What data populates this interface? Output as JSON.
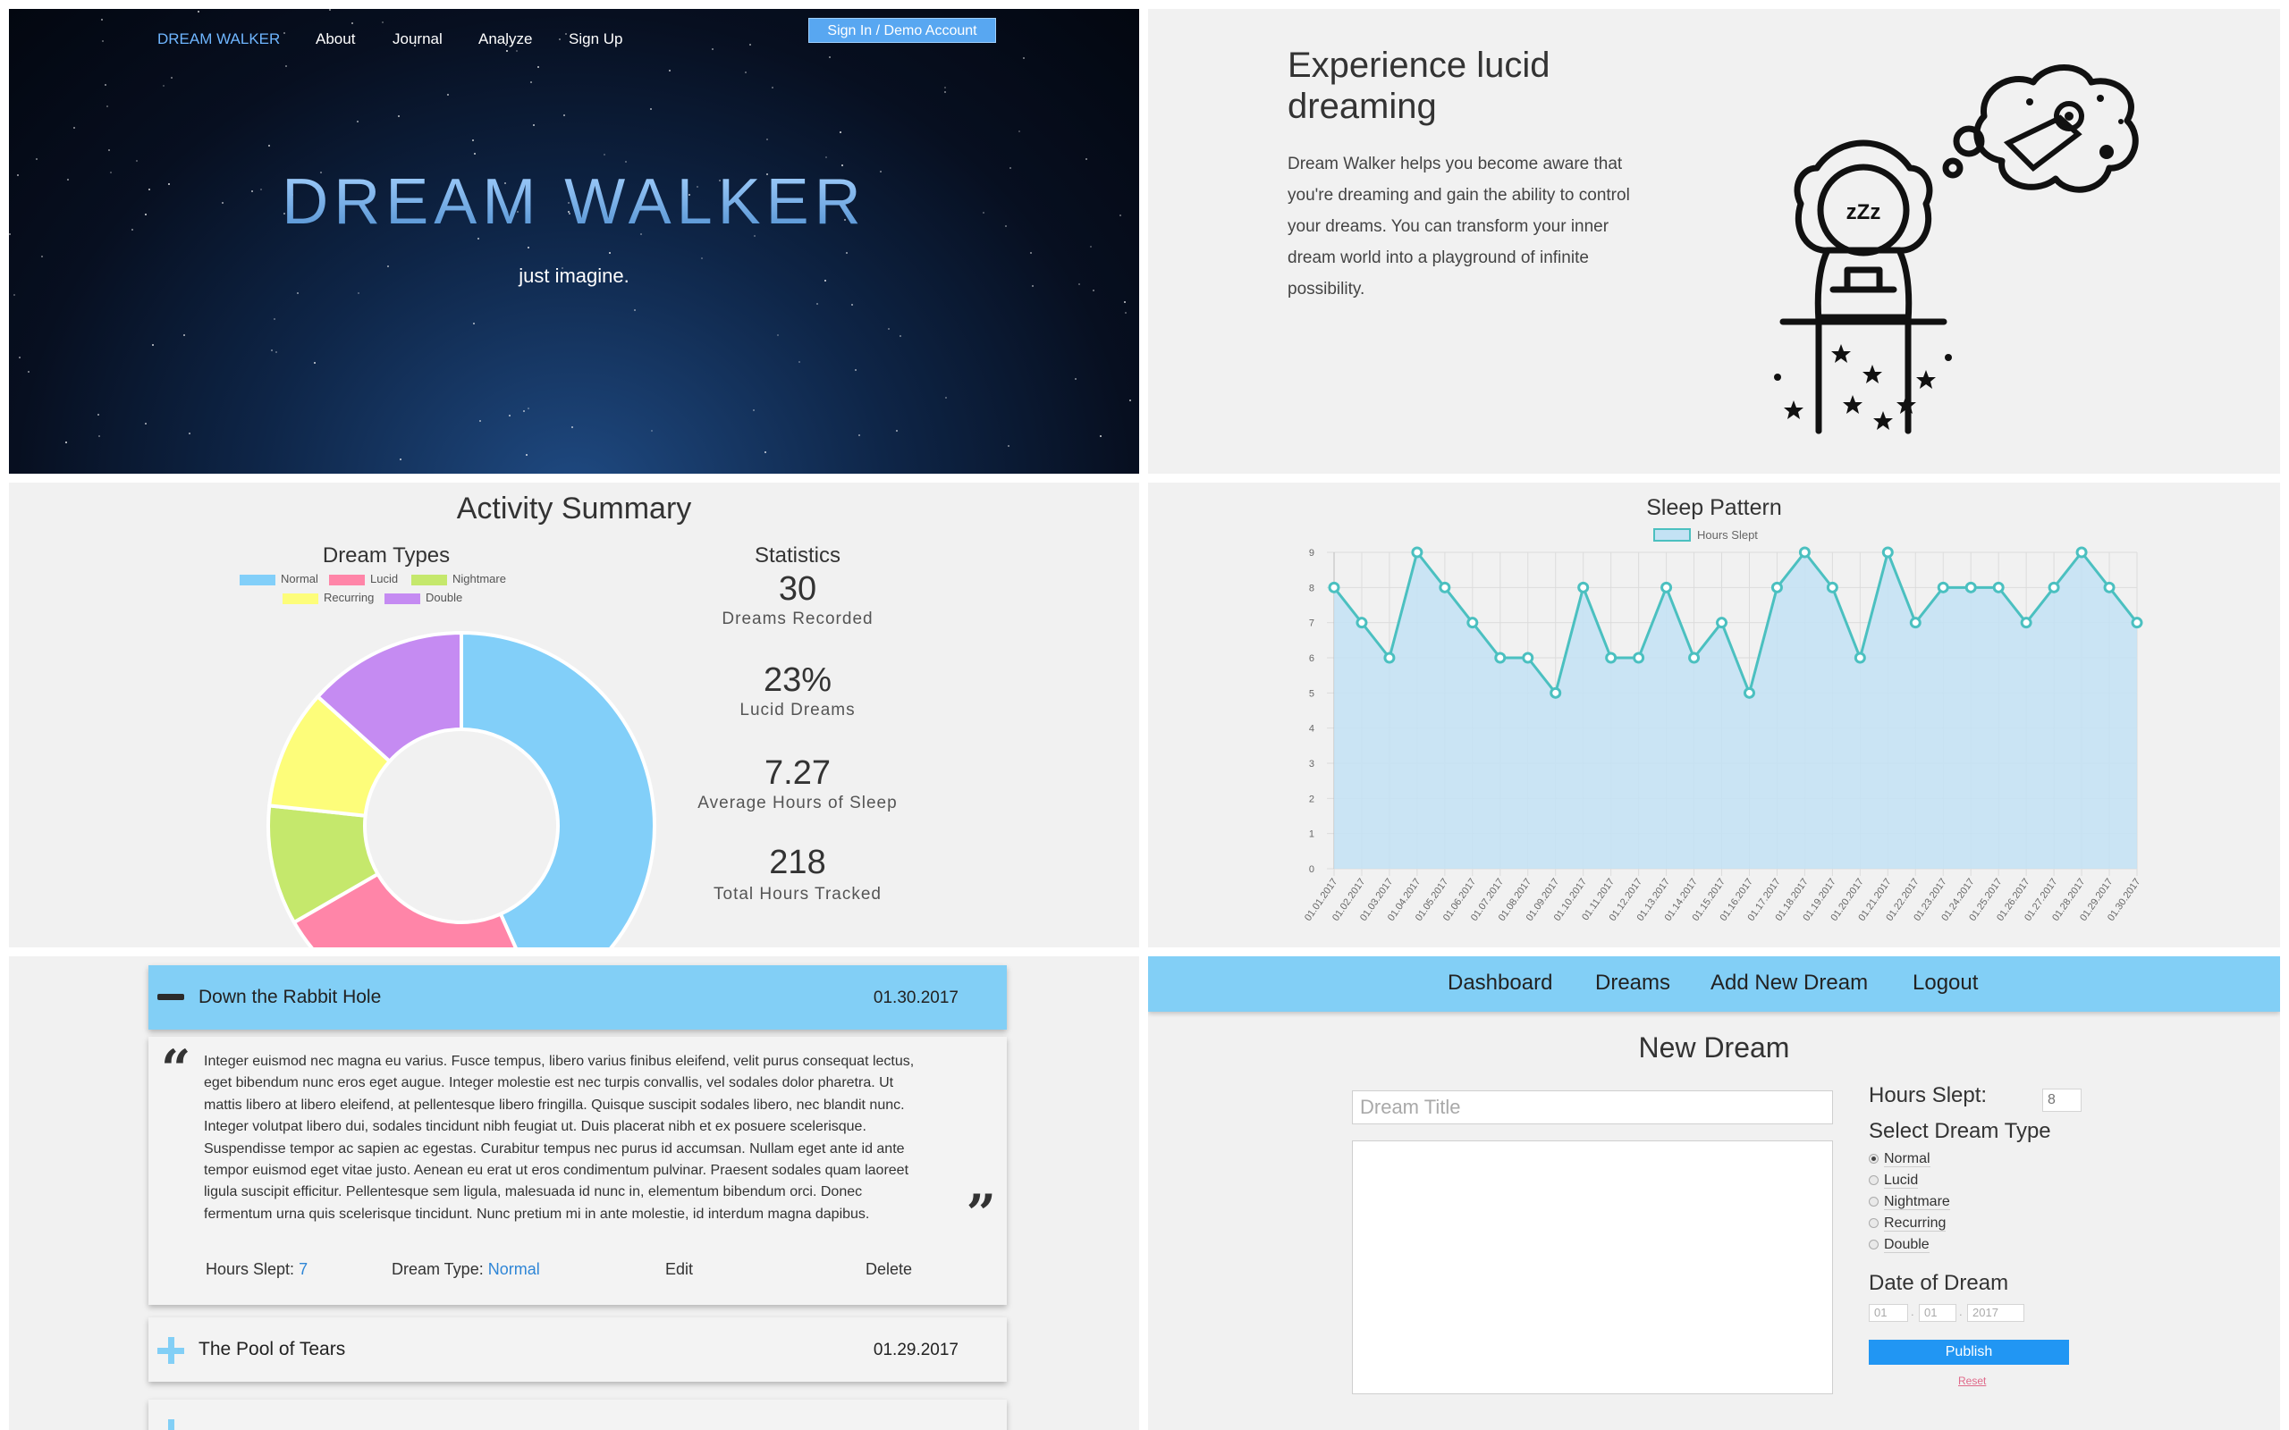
{
  "hero": {
    "nav": {
      "brand": "DREAM WALKER",
      "about": "About",
      "journal": "Journal",
      "analyze": "Analyze",
      "signup": "Sign Up",
      "signin": "Sign In / Demo Account"
    },
    "title": "DREAM WALKER",
    "subtitle": "just imagine."
  },
  "intro": {
    "title_line1": "Experience lucid",
    "title_line2": "dreaming",
    "text_lines": [
      "Dream Walker helps you become aware that",
      "you're dreaming and gain the ability to control",
      "your dreams. You can transform your inner",
      "dream world into a playground of infinite",
      "possibility."
    ],
    "illustration_label": "zZz"
  },
  "activity": {
    "title": "Activity Summary",
    "dream_types_title": "Dream Types",
    "stats_title": "Statistics",
    "stats": [
      {
        "value": "30",
        "label": "Dreams Recorded"
      },
      {
        "value": "23%",
        "label": "Lucid Dreams"
      },
      {
        "value": "7.27",
        "label": "Average Hours of Sleep"
      },
      {
        "value": "218",
        "label": "Total Hours Tracked"
      }
    ]
  },
  "sleep": {
    "title": "Sleep Pattern"
  },
  "journal": {
    "entries": [
      {
        "title": "Down the Rabbit Hole",
        "date": "01.30.2017",
        "body_lines": [
          "Integer euismod nec magna eu varius. Fusce tempus, libero varius finibus eleifend, velit purus consequat lectus,",
          "eget bibendum nunc eros eget augue. Integer molestie est nec turpis convallis, vel sodales dolor pharetra. Ut",
          "mattis libero at libero eleifend, at pellentesque libero fringilla. Quisque suscipit sodales libero, nec blandit nunc.",
          "Integer volutpat libero dui, sodales tincidunt nibh feugiat ut. Duis placerat nibh et ex posuere scelerisque.",
          "Suspendisse tempor ac sapien ac egestas. Curabitur tempus nec purus id accumsan. Nullam eget ante id ante",
          "tempor euismod eget vitae justo. Aenean eu erat ut eros condimentum pulvinar. Praesent sodales quam laoreet",
          "ligula suscipit efficitur. Pellentesque sem ligula, malesuada id nunc in, elementum bibendum orci. Donec",
          "fermentum urna quis scelerisque tincidunt. Nunc pretium mi in ante molestie, id interdum magna dapibus."
        ],
        "hours_label": "Hours Slept:",
        "hours_value": "7",
        "type_label": "Dream Type:",
        "type_value": "Normal",
        "edit": "Edit",
        "delete": "Delete"
      },
      {
        "title": "The Pool of Tears",
        "date": "01.29.2017"
      }
    ]
  },
  "form": {
    "nav": {
      "dashboard": "Dashboard",
      "dreams": "Dreams",
      "add": "Add New Dream",
      "logout": "Logout"
    },
    "title": "New Dream",
    "title_placeholder": "Dream Title",
    "hours_label": "Hours Slept:",
    "hours_placeholder": "8",
    "type_label": "Select Dream Type",
    "types": [
      "Normal",
      "Lucid",
      "Nightmare",
      "Recurring",
      "Double"
    ],
    "selected_type": "Normal",
    "date_label": "Date of Dream",
    "date_month": "01",
    "date_day": "01",
    "date_year": "2017",
    "publish": "Publish",
    "reset": "Reset"
  },
  "chart_data": [
    {
      "type": "pie",
      "title": "Dream Types",
      "donut": true,
      "labels": [
        "Normal",
        "Lucid",
        "Nightmare",
        "Recurring",
        "Double"
      ],
      "values": [
        13,
        7,
        3,
        3,
        4
      ],
      "colors": [
        "#82cff9",
        "#ff85a8",
        "#c5e86c",
        "#fdfd7a",
        "#c58bf2"
      ],
      "legend": "top"
    },
    {
      "type": "area",
      "title": "Sleep Pattern",
      "series": [
        {
          "name": "Hours Slept",
          "values": [
            8,
            7,
            6,
            9,
            8,
            7,
            6,
            6,
            5,
            8,
            6,
            6,
            8,
            6,
            7,
            5,
            8,
            9,
            8,
            6,
            9,
            7,
            8,
            8,
            8,
            7,
            8,
            9,
            8,
            7
          ]
        }
      ],
      "x": [
        "01.01.2017",
        "01.02.2017",
        "01.03.2017",
        "01.04.2017",
        "01.05.2017",
        "01.06.2017",
        "01.07.2017",
        "01.08.2017",
        "01.09.2017",
        "01.10.2017",
        "01.11.2017",
        "01.12.2017",
        "01.13.2017",
        "01.14.2017",
        "01.15.2017",
        "01.16.2017",
        "01.17.2017",
        "01.18.2017",
        "01.19.2017",
        "01.20.2017",
        "01.21.2017",
        "01.22.2017",
        "01.23.2017",
        "01.24.2017",
        "01.25.2017",
        "01.26.2017",
        "01.27.2017",
        "01.28.2017",
        "01.29.2017",
        "01.30.2017"
      ],
      "ylim": [
        0,
        9
      ],
      "yticks": [
        0,
        1,
        2,
        3,
        4,
        5,
        6,
        7,
        8,
        9
      ],
      "grid": true,
      "legend": "top",
      "line_color": "#4bc0c0",
      "fill_color": "#c3e2f4"
    }
  ]
}
